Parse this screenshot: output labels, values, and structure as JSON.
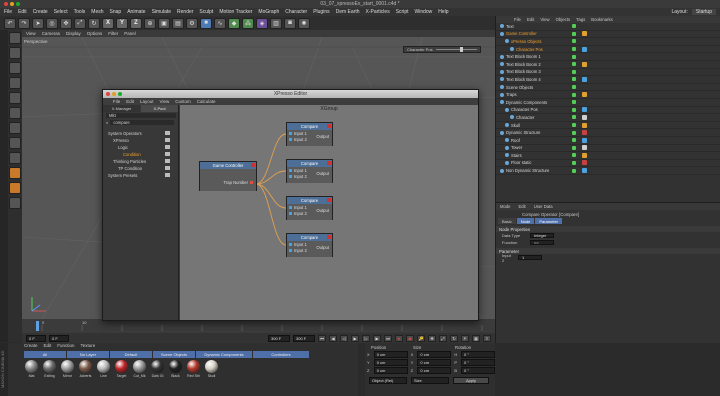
{
  "window": {
    "title": "03_07_xpressoEx_start_0001.c4d *"
  },
  "menubar": {
    "items": [
      "File",
      "Edit",
      "Create",
      "Select",
      "Tools",
      "Mesh",
      "Snap",
      "Animate",
      "Simulate",
      "Render",
      "Sculpt",
      "Motion Tracker",
      "MoGraph",
      "Character",
      "Plugins",
      "Dem Earth",
      "X-Particles",
      "Script",
      "Window",
      "Help"
    ],
    "layout_label": "Layout:",
    "layout_value": "Startup"
  },
  "toolbar": {
    "xyz": [
      "X",
      "Y",
      "Z"
    ]
  },
  "viewport": {
    "menu": [
      "View",
      "Cameras",
      "Display",
      "Options",
      "Filter",
      "Panel"
    ],
    "label": "Perspective",
    "slider_label": "Character Pos"
  },
  "timeline": {
    "start_field": "0 F",
    "end_field": "300 F",
    "end_field2": "300 F",
    "ticks": [
      "0",
      "10"
    ]
  },
  "material_manager": {
    "menu": [
      "Create",
      "Edit",
      "Function",
      "Texture"
    ],
    "tabs": [
      "All",
      "No Layer",
      "Default",
      "Scene Objects",
      "Dynamic Components",
      "Controllers"
    ],
    "materials": [
      {
        "name": "Mat",
        "color": "#8a8a8a"
      },
      {
        "name": "Exiting",
        "color": "#6e6e6e"
      },
      {
        "name": "Mirror",
        "color": "#a0a0a0"
      },
      {
        "name": "Adverts",
        "color": "#7b5a4a"
      },
      {
        "name": "Line",
        "color": "#bbbbbb"
      },
      {
        "name": "Target",
        "color": "#c0262a"
      },
      {
        "name": "Cut_Mk",
        "color": "#9a9a9a"
      },
      {
        "name": "Dark Gl",
        "color": "#333333"
      },
      {
        "name": "Black",
        "color": "#222222"
      },
      {
        "name": "Red Stri",
        "color": "#b33a2c"
      },
      {
        "name": "Skull",
        "color": "#d6d0c4"
      }
    ]
  },
  "coords": {
    "headers": [
      "Position",
      "Size",
      "Rotation"
    ],
    "rows": [
      {
        "axis": "X",
        "pos": "0 cm",
        "size": "0 cm",
        "rot_axis": "H",
        "rot": "0 °"
      },
      {
        "axis": "Y",
        "pos": "0 cm",
        "size": "0 cm",
        "rot_axis": "P",
        "rot": "0 °"
      },
      {
        "axis": "Z",
        "pos": "0 cm",
        "size": "0 cm",
        "rot_axis": "B",
        "rot": "0 °"
      }
    ],
    "mode": "Object (Rel)",
    "size_mode": "Size",
    "apply": "Apply"
  },
  "xpresso": {
    "title": "XPresso Editor",
    "menu": [
      "File",
      "Edit",
      "Layout",
      "View",
      "Custom",
      "Calculate"
    ],
    "tabs": [
      "X-Manager",
      "X-Pool"
    ],
    "search_label": "Mkt",
    "search_value": "compare",
    "tree": [
      {
        "label": "System Operators",
        "indent": 1
      },
      {
        "label": "XPresso",
        "indent": 2
      },
      {
        "label": "Logic",
        "indent": 3
      },
      {
        "label": "Condition",
        "indent": 4,
        "highlight": true
      },
      {
        "label": "Thinking Particles",
        "indent": 2
      },
      {
        "label": "TP Condition",
        "indent": 3
      },
      {
        "label": "System Presets",
        "indent": 1
      }
    ],
    "canvas_title": "XGroup",
    "source_node": {
      "title": "Game Controller",
      "port": "Trap Number"
    },
    "compare_nodes": [
      {
        "title": "Compare",
        "in1": "Input 1",
        "in2": "Input 2",
        "out": "Output"
      },
      {
        "title": "Compare",
        "in1": "Input 1",
        "in2": "Input 2",
        "out": "Output"
      },
      {
        "title": "Compare",
        "in1": "Input 1",
        "in2": "Input 2",
        "out": "Output"
      },
      {
        "title": "Compare",
        "in1": "Input 1",
        "in2": "Input 2",
        "out": "Output"
      }
    ]
  },
  "objects": {
    "menu": [
      "File",
      "Edit",
      "View",
      "Objects",
      "Tags",
      "Bookmarks"
    ],
    "rows": [
      {
        "label": "Text",
        "indent": 0,
        "color": "#d8d8d8"
      },
      {
        "label": "Game Controller",
        "indent": 0,
        "color": "#f0a030"
      },
      {
        "label": "xPresso Objects",
        "indent": 1,
        "color": "#f0a030"
      },
      {
        "label": "Character Pos",
        "indent": 2,
        "color": "#f0a030"
      },
      {
        "label": "Text Block Boom 1",
        "indent": 0,
        "color": "#d8d8d8"
      },
      {
        "label": "Text Block Boom 2",
        "indent": 0,
        "color": "#d8d8d8"
      },
      {
        "label": "Text Block Boom 3",
        "indent": 0,
        "color": "#d8d8d8"
      },
      {
        "label": "Text Block Boom 4",
        "indent": 0,
        "color": "#d8d8d8"
      },
      {
        "label": "Scene Objects",
        "indent": 0,
        "color": "#d8d8d8"
      },
      {
        "label": "Traps",
        "indent": 0,
        "color": "#d8d8d8"
      },
      {
        "label": "Dynamic Components",
        "indent": 0,
        "color": "#d8d8d8"
      },
      {
        "label": "Character Pos",
        "indent": 1,
        "color": "#d8d8d8"
      },
      {
        "label": "Character",
        "indent": 2,
        "color": "#d8d8d8"
      },
      {
        "label": "Skull",
        "indent": 1,
        "color": "#d8d8d8"
      },
      {
        "label": "Dynamic Structure",
        "indent": 0,
        "color": "#d8d8d8"
      },
      {
        "label": "Roof",
        "indent": 1,
        "color": "#d8d8d8"
      },
      {
        "label": "Tower",
        "indent": 1,
        "color": "#d8d8d8"
      },
      {
        "label": "Stairs",
        "indent": 1,
        "color": "#d8d8d8"
      },
      {
        "label": "Floor static",
        "indent": 1,
        "color": "#d8d8d8"
      },
      {
        "label": "Non Dynamic Structure",
        "indent": 0,
        "color": "#d8d8d8"
      }
    ]
  },
  "attributes": {
    "menu": [
      "Mode",
      "Edit",
      "User Data"
    ],
    "title": "Compare Operator [Compare]",
    "tabs": [
      "Basic",
      "Node",
      "Parameter"
    ],
    "node_section": "Node Properties",
    "data_type_label": "Data Type",
    "data_type_value": "Integer",
    "function_label": "Function",
    "function_value": "==",
    "param_section": "Parameter",
    "input2_label": "Input 2",
    "input2_value": "1"
  },
  "side_labels": {
    "left": "MAXON CINEMA 4D"
  }
}
